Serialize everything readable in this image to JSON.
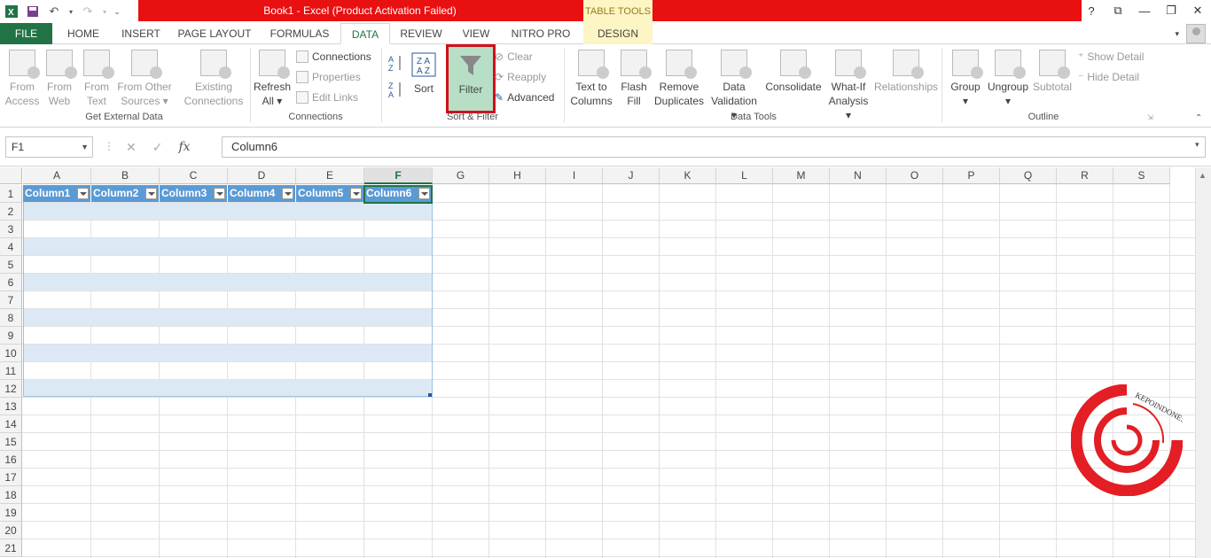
{
  "window": {
    "title": "Book1 -  Excel (Product Activation Failed)",
    "contextual_group": "TABLE TOOLS",
    "controls": [
      "?",
      "⧉",
      "—",
      "❐",
      "✕"
    ]
  },
  "tabs": [
    "FILE",
    "HOME",
    "INSERT",
    "PAGE LAYOUT",
    "FORMULAS",
    "DATA",
    "REVIEW",
    "VIEW",
    "NITRO PRO",
    "DESIGN"
  ],
  "active_tab": "DATA",
  "ribbon": {
    "get_external": {
      "label": "Get External Data",
      "buttons": [
        [
          "From",
          "Access"
        ],
        [
          "From",
          "Web"
        ],
        [
          "From",
          "Text"
        ],
        [
          "From Other",
          "Sources ▾"
        ],
        [
          "Existing",
          "Connections"
        ]
      ]
    },
    "connections": {
      "label": "Connections",
      "refresh": [
        "Refresh",
        "All ▾"
      ],
      "items": [
        "Connections",
        "Properties",
        "Edit Links"
      ]
    },
    "sort_filter": {
      "label": "Sort & Filter",
      "sort": "Sort",
      "filter": "Filter",
      "items": [
        "Clear",
        "Reapply",
        "Advanced"
      ]
    },
    "data_tools": {
      "label": "Data Tools",
      "buttons": [
        [
          "Text to",
          "Columns"
        ],
        [
          "Flash",
          "Fill"
        ],
        [
          "Remove",
          "Duplicates"
        ],
        [
          "Data",
          "Validation ▾"
        ],
        [
          "Consolidate",
          ""
        ],
        [
          "What-If",
          "Analysis ▾"
        ],
        [
          "Relationships",
          ""
        ]
      ]
    },
    "outline": {
      "label": "Outline",
      "buttons": [
        [
          "Group",
          "▾"
        ],
        [
          "Ungroup",
          "▾"
        ],
        [
          "Subtotal",
          ""
        ]
      ],
      "items": [
        "Show Detail",
        "Hide Detail"
      ]
    }
  },
  "formula_bar": {
    "name_box": "F1",
    "formula": "Column6",
    "fx": "fx"
  },
  "grid": {
    "columns": [
      "A",
      "B",
      "C",
      "D",
      "E",
      "F",
      "G",
      "H",
      "I",
      "J",
      "K",
      "L",
      "M",
      "N",
      "O",
      "P",
      "Q",
      "R",
      "S"
    ],
    "rows": [
      "1",
      "2",
      "3",
      "4",
      "5",
      "6",
      "7",
      "8",
      "9",
      "10",
      "11",
      "12",
      "13",
      "14",
      "15",
      "16",
      "17",
      "18",
      "19",
      "20",
      "21"
    ],
    "table_headers": [
      "Column1",
      "Column2",
      "Column3",
      "Column4",
      "Column5",
      "Column6"
    ],
    "selected_column": "F"
  },
  "watermark": {
    "text": "KEPOINDONESIA",
    "color": "#e31e24"
  }
}
